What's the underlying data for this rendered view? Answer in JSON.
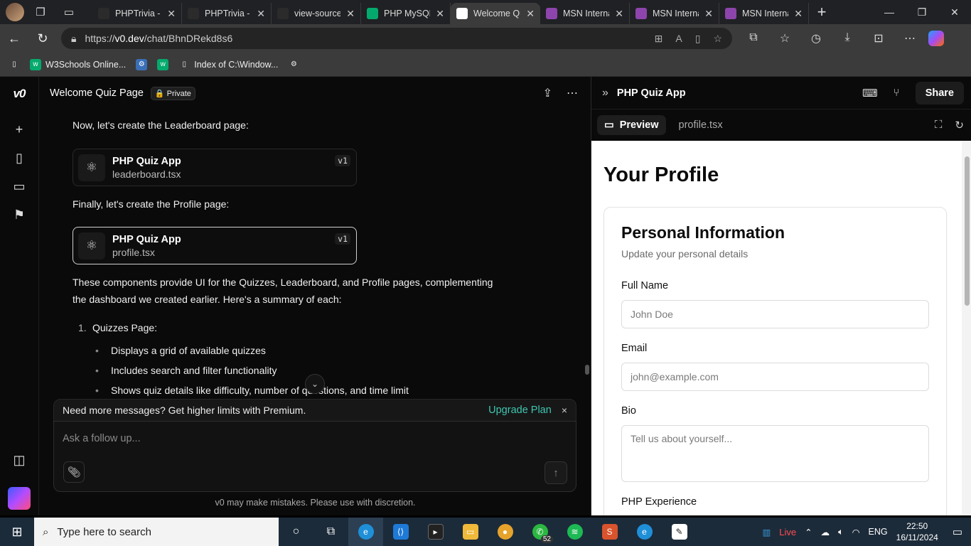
{
  "browser": {
    "tabs": [
      {
        "title": "PHPTrivia - D",
        "fav_color": "#2b2b2b",
        "active": false
      },
      {
        "title": "PHPTrivia - D",
        "fav_color": "#2b2b2b",
        "active": false
      },
      {
        "title": "view-source:",
        "fav_color": "#2b2b2b",
        "active": false
      },
      {
        "title": "PHP MySQL",
        "fav_color": "#04aa6d",
        "active": false
      },
      {
        "title": "Welcome Qu",
        "fav_color": "#ffffff",
        "active": true
      },
      {
        "title": "MSN Interna",
        "fav_color": "#8e44ad",
        "active": false
      },
      {
        "title": "MSN Interna",
        "fav_color": "#8e44ad",
        "active": false
      },
      {
        "title": "MSN Interna",
        "fav_color": "#8e44ad",
        "active": false
      }
    ],
    "url_prefix": "https://",
    "url_host": "v0.dev",
    "url_path": "/chat/BhnDRekd8s6",
    "bookmarks": {
      "w3schools": "W3Schools Online...",
      "index": "Index of C:\\Window..."
    }
  },
  "chat": {
    "title": "Welcome Quiz Page",
    "privacy_badge": "🔒 Private",
    "text_leaderboard_intro": "Now, let's create the Leaderboard page:",
    "card1": {
      "name": "PHP Quiz App",
      "file": "leaderboard.tsx",
      "version": "v1"
    },
    "text_profile_intro": "Finally, let's create the Profile page:",
    "card2": {
      "name": "PHP Quiz App",
      "file": "profile.tsx",
      "version": "v1"
    },
    "summary_line1": "These components provide UI for the Quizzes, Leaderboard, and Profile pages, complementing",
    "summary_line2": "the dashboard we created earlier. Here's a summary of each:",
    "list_num": "1.",
    "list_item": "Quizzes Page:",
    "bullets": [
      "Displays a grid of available quizzes",
      "Includes search and filter functionality",
      "Shows quiz details like difficulty, number of questions, and time limit"
    ],
    "upsell_text": "Need more messages? Get higher limits with Premium.",
    "upsell_link": "Upgrade Plan",
    "upsell_close": "×",
    "composer_placeholder": "Ask a follow up...",
    "disclaimer": "v0 may make mistakes. Please use with discretion."
  },
  "panel": {
    "title": "PHP Quiz App",
    "share": "Share",
    "tab_preview": "Preview",
    "tab_file": "profile.tsx"
  },
  "preview": {
    "heading": "Your Profile",
    "card_title": "Personal Information",
    "card_subtitle": "Update your personal details",
    "full_name_label": "Full Name",
    "full_name_placeholder": "John Doe",
    "email_label": "Email",
    "email_placeholder": "john@example.com",
    "bio_label": "Bio",
    "bio_placeholder": "Tell us about yourself...",
    "php_exp_label": "PHP Experience"
  },
  "taskbar": {
    "search_placeholder": "Type here to search",
    "whatsapp_badge": "52",
    "live": "Live",
    "lang": "ENG",
    "time": "22:50",
    "date": "16/11/2024"
  },
  "colors": {
    "accent_link": "#3fc6b0",
    "app_bg": "#0a0a0a",
    "taskbar": "#1c2b3a"
  }
}
